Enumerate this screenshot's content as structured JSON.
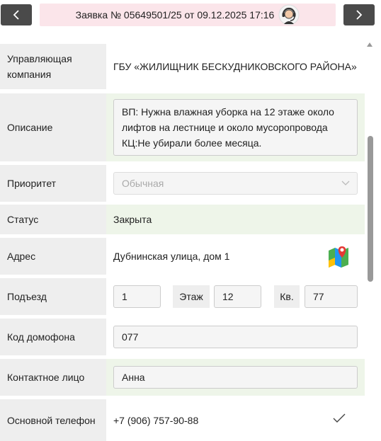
{
  "header": {
    "title": "Заявка № 05649501/25 от 09.12.2025 17:16",
    "prev_icon": "chevron-left-icon",
    "next_icon": "chevron-right-icon",
    "support_icon": "headset-operator-icon"
  },
  "form": {
    "company": {
      "label": "Управляющая компания",
      "value": "ГБУ «ЖИЛИЩНИК БЕСКУДНИКОВСКОГО РАЙОНА»"
    },
    "description": {
      "label": "Описание",
      "value": "ВП: Нужна влажная уборка на 12 этаже около лифтов на лестнице и около мусоропровода КЦ:Не убирали более месяца."
    },
    "priority": {
      "label": "Приоритет",
      "value": "Обычная"
    },
    "status": {
      "label": "Статус",
      "value": "Закрыта"
    },
    "address": {
      "label": "Адрес",
      "value": "Дубнинская улица, дом 1",
      "map_icon": "map-icon"
    },
    "entrance": {
      "label": "Подъезд",
      "value": "1",
      "floor_label": "Этаж",
      "floor_value": "12",
      "apt_label": "Кв.",
      "apt_value": "77"
    },
    "intercom": {
      "label": "Код домофона",
      "value": "077"
    },
    "contact": {
      "label": "Контактное лицо",
      "value": "Анна"
    },
    "phone": {
      "label": "Основной телефон",
      "value": "+7 (906) 757-90-88",
      "check_icon": "checkmark-icon"
    }
  },
  "colors": {
    "nav_button": "#4a4a4a",
    "title_bg": "#fbe5ea",
    "label_bg": "#eeeeee",
    "row_green": "#eef5e9"
  }
}
